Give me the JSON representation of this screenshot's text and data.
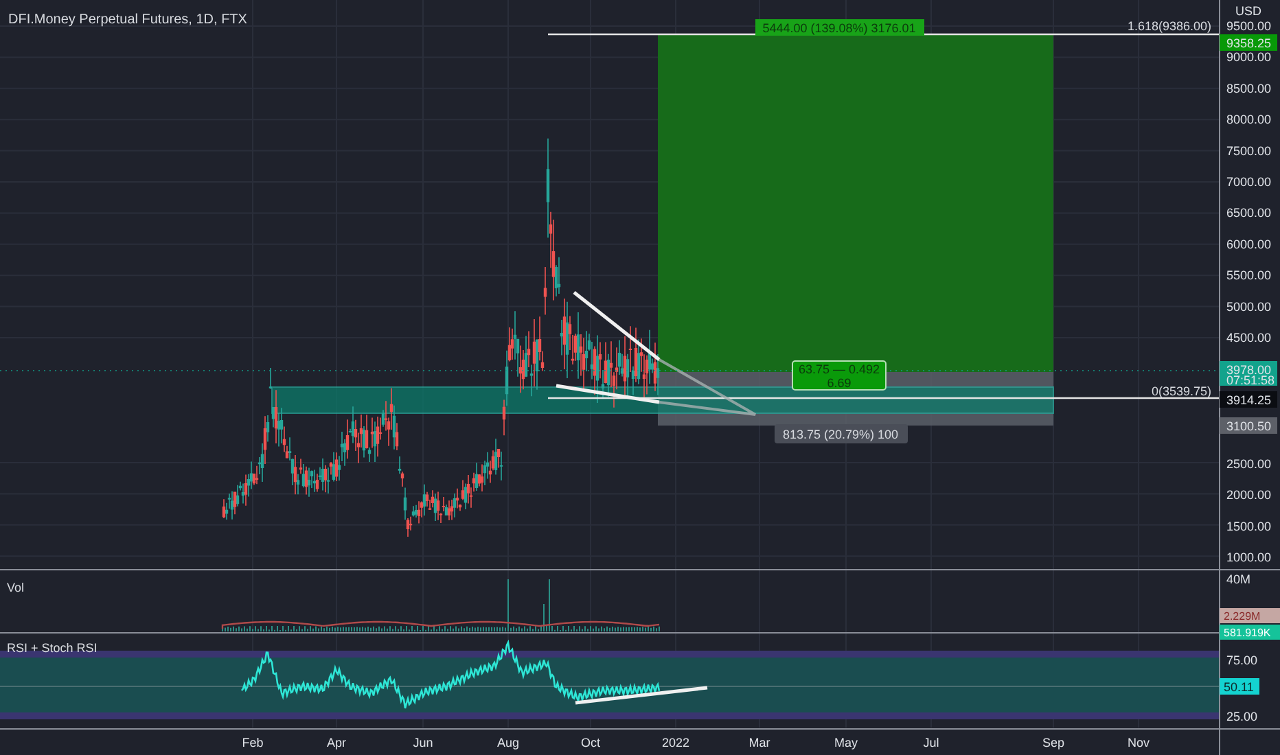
{
  "title": "DFI.Money Perpetual Futures, 1D, FTX",
  "price_axis": {
    "unit": "USD",
    "upper_ticks": [
      "9500.00",
      "9000.00",
      "8500.00",
      "8000.00",
      "7500.00",
      "7000.00",
      "6500.00",
      "6000.00",
      "5500.00",
      "5000.00",
      "4500.00"
    ],
    "lower_ticks": [
      "2500.00",
      "2000.00",
      "1500.00",
      "1000.00"
    ]
  },
  "price_badges": [
    {
      "kind": "target",
      "label": "9358.25",
      "color": "#089908"
    },
    {
      "kind": "last",
      "label": "3978.00",
      "sublabel": "07:51:58",
      "color": "#12a38c"
    },
    {
      "kind": "level",
      "label": "3914.25",
      "color": "#0b0d12"
    },
    {
      "kind": "stop",
      "label": "3100.50",
      "color": "#5d6068"
    }
  ],
  "fib_labels": [
    "1.618(9386.00)",
    "0(3539.75)"
  ],
  "position": {
    "profit_label": "5444.00 (139.08%) 3176.01",
    "ratio_label": "63.75 — 0.492",
    "ratio_sublabel": "6.69",
    "risk_label": "813.75 (20.79%) 100"
  },
  "volume_pane": {
    "title": "Vol",
    "tick": "40M",
    "badges": [
      {
        "label": "2.229M",
        "color": "#c5a7a3"
      },
      {
        "label": "581.919K",
        "color": "#15c39a"
      }
    ]
  },
  "rsi_pane": {
    "title": "RSI + Stoch RSI",
    "upper_tick": "75.00",
    "lower_tick": "25.00",
    "badge": "50.11"
  },
  "time_axis": [
    "Feb",
    "Apr",
    "Jun",
    "Aug",
    "Oct",
    "2022",
    "Mar",
    "May",
    "Jul",
    "Sep",
    "Nov"
  ]
}
